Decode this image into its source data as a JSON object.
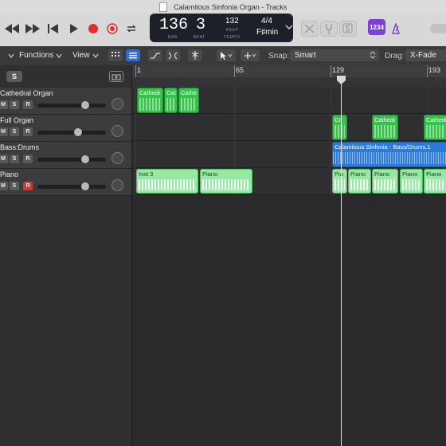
{
  "window": {
    "title": "Calamitous Sinfonia Organ - Tracks"
  },
  "lcd": {
    "bar": "136",
    "beat": "3",
    "bar_label": "BAR",
    "beat_label": "BEAT",
    "tempo": "132",
    "tempo_mode": "KEEP",
    "tempo_label": "TEMPO",
    "signature": "4/4",
    "key": "F♯min"
  },
  "display_badge": "1234",
  "toolbar": {
    "functions_label": "Functions",
    "view_label": "View",
    "snap_label": "Snap:",
    "snap_value": "Smart",
    "drag_label": "Drag:",
    "drag_value": "X-Fade"
  },
  "track_header": {
    "global_solo": "S"
  },
  "ruler": {
    "markers": [
      "1",
      "65",
      "129",
      "193"
    ]
  },
  "tracks": [
    {
      "name": "Cathedral Organ",
      "m": "M",
      "s": "S",
      "r": "R",
      "volume": 0.73,
      "record_armed": false
    },
    {
      "name": "Full Organ",
      "m": "M",
      "s": "S",
      "r": "R",
      "volume": 0.6,
      "record_armed": false
    },
    {
      "name": "Bass:Drums",
      "m": "M",
      "s": "S",
      "r": "R",
      "volume": 0.73,
      "record_armed": false
    },
    {
      "name": "Piano",
      "m": "M",
      "s": "S",
      "r": "R",
      "volume": 0.73,
      "record_armed": true
    }
  ],
  "regions": {
    "organ": [
      "Cathedr",
      "Cat",
      "Cathe"
    ],
    "full_organ": [
      "Cri",
      "Cathedr",
      "Cathedr"
    ],
    "bass_drums": "Calamitous Sinfonia - Bass/Drums.1",
    "piano": [
      "Inst 3",
      "Piano",
      "Pia",
      "Piano",
      "Piano",
      "Piano",
      "Piano"
    ]
  },
  "colors": {
    "organ_region": "#35c24a",
    "audio_region": "#2d7bd6",
    "piano_region": "#97e8a3",
    "record": "#e0302b",
    "accent_blue": "#2f6ccf",
    "display_purple": "#7d3fd6"
  }
}
